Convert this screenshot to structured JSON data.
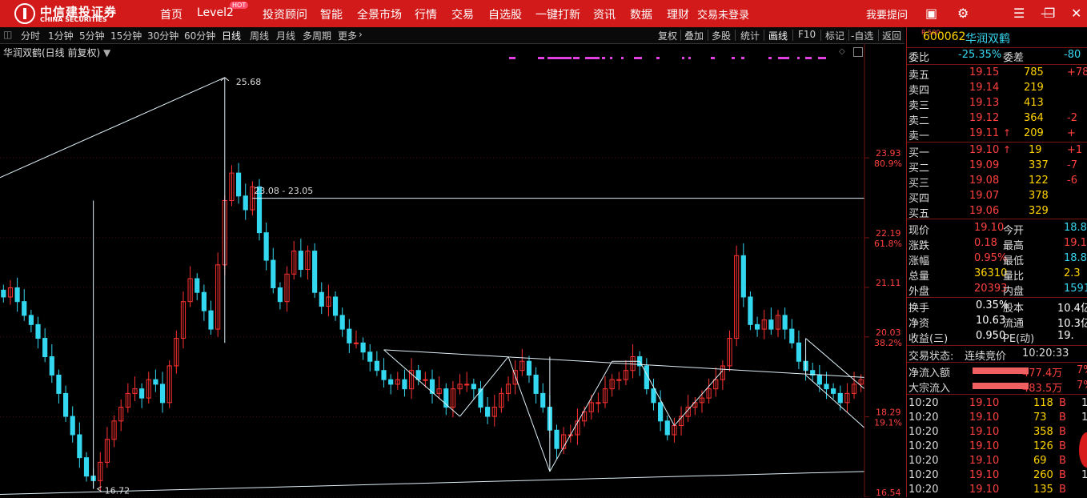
{
  "topbar": {
    "logo_cn": "中信建投证券",
    "logo_en": "CHINA SECURITIES",
    "nav": [
      "首页",
      "Level2",
      "投资顾问",
      "智能",
      "全景市场",
      "行情",
      "交易",
      "自选股",
      "一键打新",
      "资讯",
      "数据",
      "理财"
    ],
    "hot_badge": "HOT",
    "login_status": "交易未登录",
    "feedback": "我要提问"
  },
  "toolbar": {
    "periods": [
      "分时",
      "1分钟",
      "5分钟",
      "15分钟",
      "30分钟",
      "60分钟",
      "日线",
      "周线",
      "月线",
      "多周期",
      "更多"
    ],
    "active_period": "日线",
    "tools": [
      "复权",
      "叠加",
      "多股",
      "统计",
      "画线",
      "F10",
      "标记",
      "-自选",
      "返回"
    ]
  },
  "chart_title": "华润双鹤(日线 前复权)",
  "chart_data": {
    "type": "candlestick",
    "price_range": [
      16.54,
      26.2
    ],
    "axis_labels": [
      {
        "price": 23.93,
        "pct": "80.9%"
      },
      {
        "price": 22.19,
        "pct": "61.8%"
      },
      {
        "price": 21.11,
        "pct": ""
      },
      {
        "price": 20.03,
        "pct": "38.2%"
      },
      {
        "price": 18.29,
        "pct": "19.1%"
      },
      {
        "price": 16.54,
        "pct": ""
      }
    ],
    "annotations": [
      {
        "text": "25.68",
        "price": 25.68
      },
      {
        "text": "16.72",
        "price": 16.72
      },
      {
        "text": "23.08 - 23.05",
        "price": 23.08
      }
    ],
    "closes": [
      20.9,
      21.1,
      20.8,
      20.5,
      20.3,
      20.0,
      19.6,
      19.2,
      18.8,
      18.3,
      17.9,
      17.4,
      17.0,
      16.9,
      17.3,
      17.8,
      18.2,
      18.5,
      18.8,
      18.9,
      18.7,
      19.1,
      19.0,
      18.6,
      19.4,
      20.0,
      20.8,
      21.3,
      21.0,
      20.6,
      20.2,
      21.6,
      23.0,
      23.6,
      23.1,
      22.8,
      23.3,
      22.3,
      21.7,
      21.1,
      20.8,
      21.4,
      21.9,
      21.5,
      21.9,
      21.0,
      20.7,
      20.9,
      20.5,
      20.2,
      19.9,
      19.9,
      19.7,
      19.5,
      19.3,
      19.1,
      19.0,
      19.1,
      18.9,
      19.3,
      19.1,
      19.1,
      18.8,
      18.9,
      18.5,
      18.9,
      19.0,
      19.0,
      18.9,
      18.5,
      18.3,
      18.5,
      18.8,
      19.0,
      19.3,
      19.5,
      19.2,
      18.8,
      18.5,
      18.0,
      17.6,
      17.9,
      17.9,
      18.2,
      18.4,
      18.6,
      18.6,
      18.9,
      19.1,
      19.1,
      19.3,
      19.6,
      19.4,
      18.9,
      18.6,
      18.2,
      17.9,
      18.1,
      18.3,
      18.5,
      18.6,
      18.7,
      18.9,
      19.1,
      19.4,
      20.0,
      21.8,
      20.9,
      20.3,
      20.2,
      20.4,
      20.2,
      20.5,
      20.2,
      19.9,
      19.5,
      19.3,
      19.2,
      19.0,
      18.9,
      18.8,
      18.6,
      18.8,
      19.0,
      19.1
    ]
  },
  "quote": {
    "badge": "R 500",
    "code": "600062",
    "name": "华润双鹤",
    "wb_label": "委比",
    "wb_value": "-25.35%",
    "wc_label": "委差",
    "wc_value": "-80",
    "asks": [
      {
        "label": "卖五",
        "price": "19.15",
        "vol": "785",
        "chg": "+78"
      },
      {
        "label": "卖四",
        "price": "19.14",
        "vol": "219",
        "chg": ""
      },
      {
        "label": "卖三",
        "price": "19.13",
        "vol": "413",
        "chg": ""
      },
      {
        "label": "卖二",
        "price": "19.12",
        "vol": "364",
        "chg": "-2"
      },
      {
        "label": "卖一",
        "price": "19.11",
        "vol": "209",
        "chg": "+"
      }
    ],
    "bids": [
      {
        "label": "买一",
        "price": "19.10",
        "vol": "19",
        "chg": "+1"
      },
      {
        "label": "买二",
        "price": "19.09",
        "vol": "337",
        "chg": "-7"
      },
      {
        "label": "买三",
        "price": "19.08",
        "vol": "122",
        "chg": "-6"
      },
      {
        "label": "买四",
        "price": "19.07",
        "vol": "378",
        "chg": ""
      },
      {
        "label": "买五",
        "price": "19.06",
        "vol": "329",
        "chg": ""
      }
    ],
    "stats": [
      {
        "l1": "现价",
        "v1": "19.10",
        "l2": "今开",
        "v2": "18.8"
      },
      {
        "l1": "涨跌",
        "v1": "0.18",
        "l2": "最高",
        "v2": "19.1"
      },
      {
        "l1": "涨幅",
        "v1": "0.95%",
        "l2": "最低",
        "v2": "18.8"
      },
      {
        "l1": "总量",
        "v1": "36310",
        "l2": "量比",
        "v2": "2.3"
      },
      {
        "l1": "外盘",
        "v1": "20393",
        "l2": "内盘",
        "v2": "1591"
      }
    ],
    "stats2": [
      {
        "l1": "换手",
        "v1": "0.35%",
        "l2": "股本",
        "v2": "10.4亿"
      },
      {
        "l1": "净资",
        "v1": "10.63",
        "l2": "流通",
        "v2": "10.3亿"
      },
      {
        "l1": "收益(三)",
        "v1": "0.950",
        "l2": "PE(动)",
        "v2": "19."
      }
    ],
    "status_label": "交易状态:",
    "status_value": "连续竞价",
    "status_time": "10:20:33",
    "flows": [
      {
        "label": "净流入额",
        "value": "477.4万",
        "pct": "7%"
      },
      {
        "label": "大宗流入",
        "value": "483.5万",
        "pct": "7%"
      }
    ],
    "ticks": [
      {
        "t": "10:20",
        "p": "19.10",
        "v": "118",
        "s": "B",
        "x": "1"
      },
      {
        "t": "10:20",
        "p": "19.10",
        "v": "73",
        "s": "B",
        "x": "1"
      },
      {
        "t": "10:20",
        "p": "19.10",
        "v": "358",
        "s": "B",
        "x": ""
      },
      {
        "t": "10:20",
        "p": "19.10",
        "v": "126",
        "s": "B",
        "x": ""
      },
      {
        "t": "10:20",
        "p": "19.10",
        "v": "69",
        "s": "B",
        "x": ""
      },
      {
        "t": "10:20",
        "p": "19.10",
        "v": "260",
        "s": "B",
        "x": "1"
      },
      {
        "t": "10:20",
        "p": "19.10",
        "v": "135",
        "s": "B",
        "x": ""
      }
    ]
  },
  "colors": {
    "up": "#ff3232",
    "down": "#33d8f0",
    "trend": "#dff0f8",
    "accent": "#d21a1a",
    "mark": "#e040e0"
  }
}
